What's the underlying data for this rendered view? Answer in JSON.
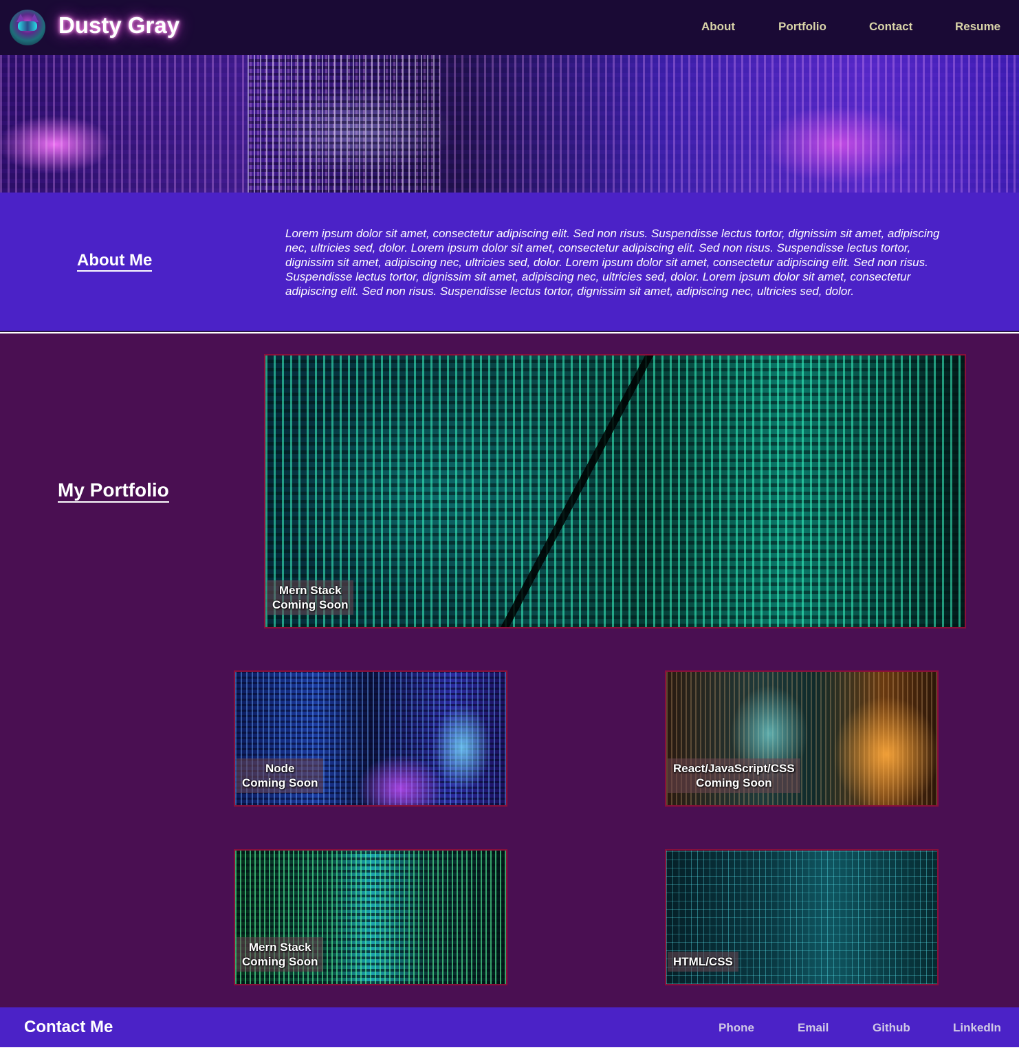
{
  "header": {
    "brand": "Dusty Gray",
    "logo_icon": "raccoon-avatar-icon",
    "nav": [
      {
        "label": "About"
      },
      {
        "label": "Portfolio"
      },
      {
        "label": "Contact"
      },
      {
        "label": "Resume"
      }
    ]
  },
  "about": {
    "heading": "About Me",
    "body": "Lorem ipsum dolor sit amet, consectetur adipiscing elit. Sed non risus. Suspendisse lectus tortor, dignissim sit amet, adipiscing nec, ultricies sed, dolor. Lorem ipsum dolor sit amet, consectetur adipiscing elit. Sed non risus. Suspendisse lectus tortor, dignissim sit amet, adipiscing nec, ultricies sed, dolor. Lorem ipsum dolor sit amet, consectetur adipiscing elit. Sed non risus. Suspendisse lectus tortor, dignissim sit amet, adipiscing nec, ultricies sed, dolor. Lorem ipsum dolor sit amet, consectetur adipiscing elit. Sed non risus. Suspendisse lectus tortor, dignissim sit amet, adipiscing nec, ultricies sed, dolor."
  },
  "portfolio": {
    "heading": "My Portfolio",
    "projects": [
      {
        "title": "Mern Stack",
        "status": "Coming Soon"
      },
      {
        "title": "Node",
        "status": "Coming Soon"
      },
      {
        "title": "React/JavaScript/CSS",
        "status": "Coming Soon"
      },
      {
        "title": "Mern Stack",
        "status": "Coming Soon"
      },
      {
        "title": "HTML/CSS",
        "status": ""
      }
    ]
  },
  "footer": {
    "heading": "Contact Me",
    "links": [
      {
        "label": "Phone"
      },
      {
        "label": "Email"
      },
      {
        "label": "Github"
      },
      {
        "label": "LinkedIn"
      }
    ]
  },
  "colors": {
    "header_bg": "#1a0a35",
    "section_accent": "#4b22c7",
    "portfolio_bg": "#4a0f52",
    "card_border": "#8a0f3a",
    "nav_text": "#d9d4a8"
  }
}
